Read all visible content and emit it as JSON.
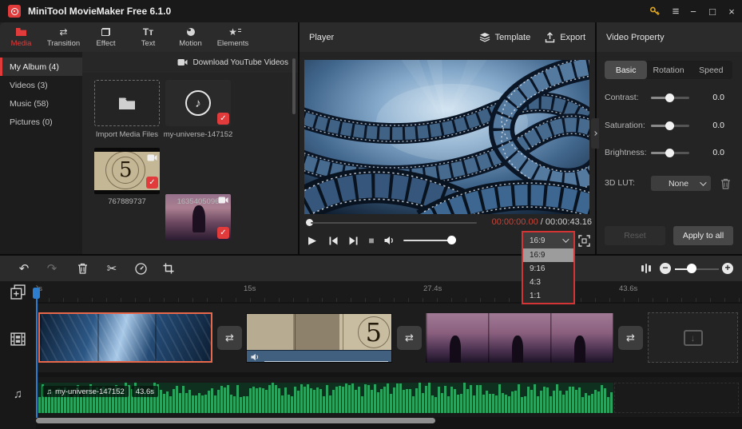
{
  "titlebar": {
    "title": "MiniTool MovieMaker Free 6.1.0"
  },
  "nav": {
    "tabs": [
      {
        "label": "Media"
      },
      {
        "label": "Transition"
      },
      {
        "label": "Effect"
      },
      {
        "label": "Text"
      },
      {
        "label": "Motion"
      },
      {
        "label": "Elements"
      }
    ]
  },
  "sidebar": {
    "items": [
      {
        "label": "My Album (4)"
      },
      {
        "label": "Videos (3)"
      },
      {
        "label": "Music (58)"
      },
      {
        "label": "Pictures (0)"
      }
    ]
  },
  "media": {
    "download_label": "Download YouTube Videos",
    "import_label": "Import Media Files",
    "countdown_digit": "5",
    "items": [
      {
        "label": "my-universe-147152"
      },
      {
        "label": "767889737"
      },
      {
        "label": "1635405096"
      }
    ]
  },
  "player": {
    "title": "Player",
    "template_label": "Template",
    "export_label": "Export",
    "current_time": "00:00:00.00",
    "time_separator": " / ",
    "total_time": "00:00:43.16",
    "aspect": {
      "selected": "16:9",
      "options": [
        "16:9",
        "9:16",
        "4:3",
        "1:1"
      ]
    }
  },
  "properties": {
    "title": "Video Property",
    "tabs": [
      "Basic",
      "Rotation",
      "Speed"
    ],
    "sliders": [
      {
        "label": "Contrast:",
        "value": "0.0"
      },
      {
        "label": "Saturation:",
        "value": "0.0"
      },
      {
        "label": "Brightness:",
        "value": "0.0"
      }
    ],
    "lut_label": "3D LUT:",
    "lut_value": "None",
    "reset_label": "Reset",
    "apply_label": "Apply to all"
  },
  "timeline": {
    "ruler": [
      "0s",
      "15s",
      "27.4s",
      "43.6s"
    ],
    "music": {
      "name": "my-universe-147152",
      "duration": "43.6s"
    }
  },
  "icons": {
    "transition": "⇄",
    "undo": "↶",
    "redo": "↷",
    "scissors": "✂",
    "play": "▶",
    "stop": "■",
    "menu": "≡",
    "minimize": "−",
    "maximize": "□",
    "close": "×",
    "check": "✓",
    "music_note": "♫",
    "note": "♪",
    "star": "★",
    "text_tab": "Tт",
    "minus": "−",
    "plus": "+",
    "down_arrow": "↓"
  },
  "colors": {
    "accent_red": "#e23b3b",
    "selection_border": "#e8684b",
    "dropdown_border": "#d53434",
    "audio_green": "#2aa35f",
    "playhead_blue": "#2d7ecf",
    "timecode_red": "#c0463a"
  }
}
